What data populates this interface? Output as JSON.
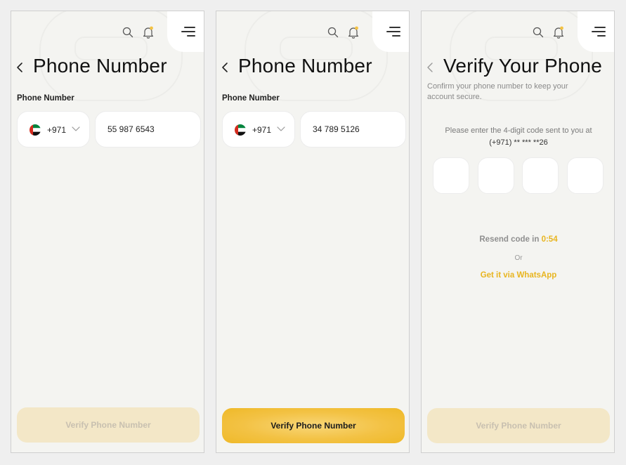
{
  "screens": [
    {
      "title": "Phone Number",
      "field_label": "Phone Number",
      "country": {
        "flag": "uae-flag",
        "dial_code": "+971"
      },
      "phone_value": "55 987 6543",
      "button_label": "Verify Phone Number",
      "button_state": "disabled"
    },
    {
      "title": "Phone Number",
      "field_label": "Phone Number",
      "country": {
        "flag": "uae-flag",
        "dial_code": "+971"
      },
      "phone_value": "34 789 5126",
      "button_label": "Verify Phone Number",
      "button_state": "enabled"
    },
    {
      "title": "Verify Your Phone",
      "subtitle": "Confirm your phone number to keep your account secure.",
      "instruction": "Please enter the 4-digit code sent to you at",
      "masked_number": "(+971) ** *** **26",
      "otp_digits": [
        "",
        "",
        "",
        ""
      ],
      "resend_label": "Resend code in",
      "resend_timer": "0:54",
      "or_label": "Or",
      "whatsapp_label": "Get it via WhatsApp",
      "button_label": "Verify Phone Number",
      "button_state": "disabled"
    }
  ],
  "colors": {
    "accent": "#f3c244",
    "link": "#e8b520",
    "background": "#f4f4f1",
    "disabled_button": "#f3e7c7",
    "notification_dot": "#f3c244"
  },
  "icons": [
    "search-icon",
    "bell-icon",
    "menu-icon",
    "back-icon",
    "chevron-down-icon",
    "uae-flag-icon"
  ]
}
